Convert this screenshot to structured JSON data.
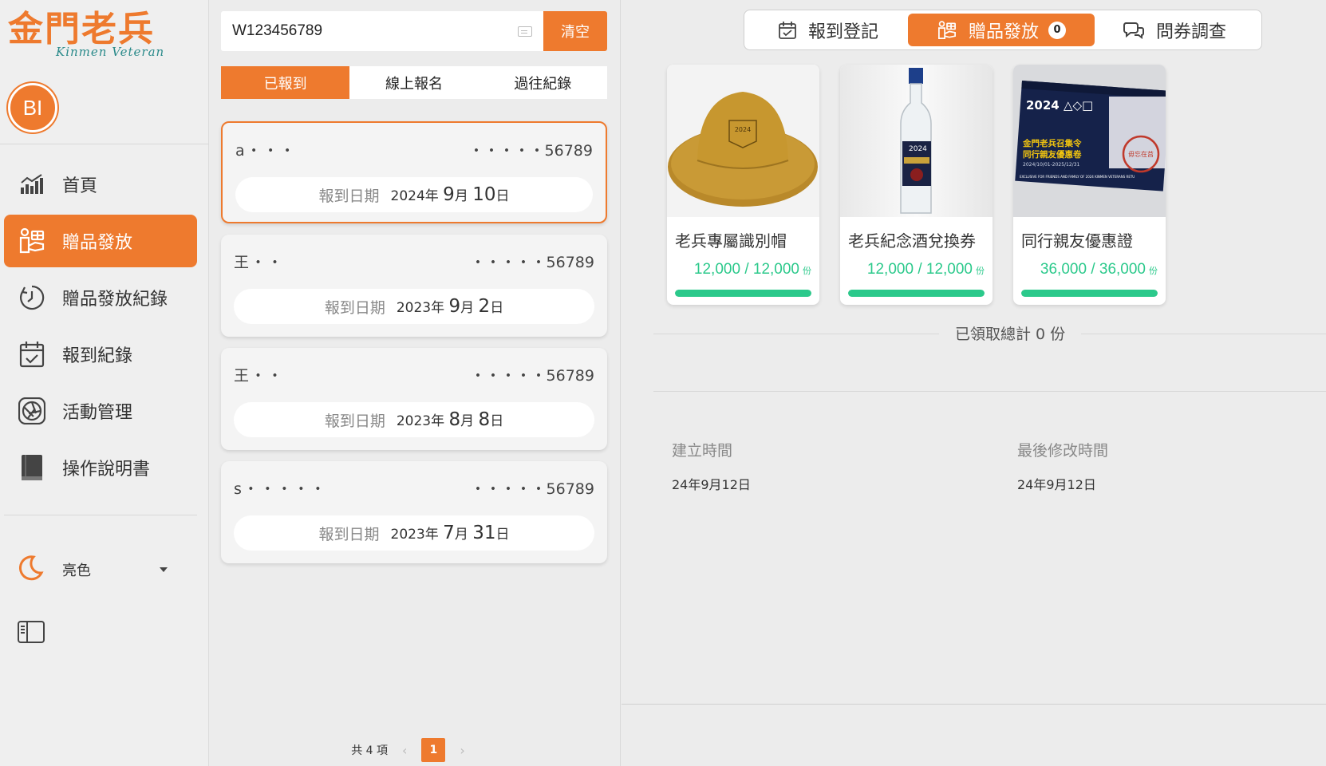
{
  "brand": {
    "name_cn": "金門老兵",
    "name_en": "Kinmen Veteran"
  },
  "user": {
    "initials": "BI"
  },
  "sidebar": {
    "items": [
      {
        "label": "首頁",
        "icon": "chart-icon"
      },
      {
        "label": "贈品發放",
        "icon": "gift-hand-icon",
        "active": true
      },
      {
        "label": "贈品發放紀錄",
        "icon": "history-icon"
      },
      {
        "label": "報到紀錄",
        "icon": "calendar-check-icon"
      },
      {
        "label": "活動管理",
        "icon": "aperture-icon"
      },
      {
        "label": "操作說明書",
        "icon": "book-icon"
      }
    ],
    "theme_label": "亮色"
  },
  "search": {
    "value": "W123456789",
    "clear_label": "清空"
  },
  "segments": [
    {
      "label": "已報到",
      "active": true
    },
    {
      "label": "線上報名"
    },
    {
      "label": "過往紀錄"
    }
  ],
  "records": [
    {
      "name": "a・・・",
      "id": "・・・・・56789",
      "date_label": "報到日期",
      "year": "2024",
      "month": "9",
      "day": "10",
      "selected": true
    },
    {
      "name": "王・・",
      "id": "・・・・・56789",
      "date_label": "報到日期",
      "year": "2023",
      "month": "9",
      "day": "2"
    },
    {
      "name": "王・・",
      "id": "・・・・・56789",
      "date_label": "報到日期",
      "year": "2023",
      "month": "8",
      "day": "8"
    },
    {
      "name": "s・・・・・",
      "id": "・・・・・56789",
      "date_label": "報到日期",
      "year": "2023",
      "month": "7",
      "day": "31"
    }
  ],
  "pagination": {
    "total_text": "共 4 項",
    "current": "1",
    "prev": "‹",
    "next": "›"
  },
  "top_tabs": [
    {
      "label": "報到登記",
      "icon": "calendar-check-icon"
    },
    {
      "label": "贈品發放",
      "icon": "gift-hand-icon",
      "active": true,
      "badge": "0"
    },
    {
      "label": "問券調查",
      "icon": "chat-icon"
    }
  ],
  "gifts": [
    {
      "name": "老兵專屬識別帽",
      "qty": "12,000 / 12,000",
      "unit": "份",
      "fill": 1.0,
      "image": "hat"
    },
    {
      "name": "老兵紀念酒兌換券",
      "qty": "12,000 / 12,000",
      "unit": "份",
      "fill": 1.0,
      "image": "bottle"
    },
    {
      "name": "同行親友優惠證",
      "qty": "36,000 / 36,000",
      "unit": "份",
      "fill": 1.0,
      "image": "card"
    }
  ],
  "gift_images": {
    "hat_text": "2024",
    "bottle_text": "2024",
    "card_year": "2024 △◇□",
    "card_title1": "金門老兵召集令",
    "card_title2": "同行親友優惠卷",
    "card_period": "2024/10/01-2025/12/31",
    "card_footer": "EXCLUSIVE FOR FRIENDS AND FAMILY OF 2024 KINMEN VETERANS RETU",
    "card_stamp": "毋忘在莒"
  },
  "summary": {
    "total_text": "已領取總計 0 份"
  },
  "meta": {
    "created_label": "建立時間",
    "created_value": "24年9月12日",
    "modified_label": "最後修改時間",
    "modified_value": "24年9月12日"
  },
  "colors": {
    "accent": "#ee7a2e",
    "progress": "#2bc98b"
  }
}
